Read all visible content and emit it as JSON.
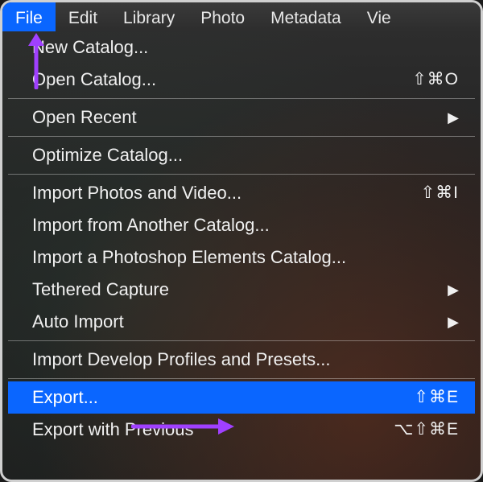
{
  "menubar": {
    "items": [
      {
        "label": "File",
        "active": true
      },
      {
        "label": "Edit"
      },
      {
        "label": "Library"
      },
      {
        "label": "Photo"
      },
      {
        "label": "Metadata"
      },
      {
        "label": "Vie"
      }
    ]
  },
  "dropdown": {
    "groups": [
      [
        {
          "label": "New Catalog...",
          "shortcut": "",
          "submenu": false
        },
        {
          "label": "Open Catalog...",
          "shortcut": "⇧⌘O",
          "submenu": false
        }
      ],
      [
        {
          "label": "Open Recent",
          "shortcut": "",
          "submenu": true
        }
      ],
      [
        {
          "label": "Optimize Catalog...",
          "shortcut": "",
          "submenu": false
        }
      ],
      [
        {
          "label": "Import Photos and Video...",
          "shortcut": "⇧⌘I",
          "submenu": false
        },
        {
          "label": "Import from Another Catalog...",
          "shortcut": "",
          "submenu": false
        },
        {
          "label": "Import a Photoshop Elements Catalog...",
          "shortcut": "",
          "submenu": false
        },
        {
          "label": "Tethered Capture",
          "shortcut": "",
          "submenu": true
        },
        {
          "label": "Auto Import",
          "shortcut": "",
          "submenu": true
        }
      ],
      [
        {
          "label": "Import Develop Profiles and Presets...",
          "shortcut": "",
          "submenu": false
        }
      ],
      [
        {
          "label": "Export...",
          "shortcut": "⇧⌘E",
          "submenu": false,
          "highlight": true
        },
        {
          "label": "Export with Previous",
          "shortcut": "⌥⇧⌘E",
          "submenu": false
        }
      ]
    ]
  },
  "annotations": {
    "arrow_color": "#a040ff"
  }
}
